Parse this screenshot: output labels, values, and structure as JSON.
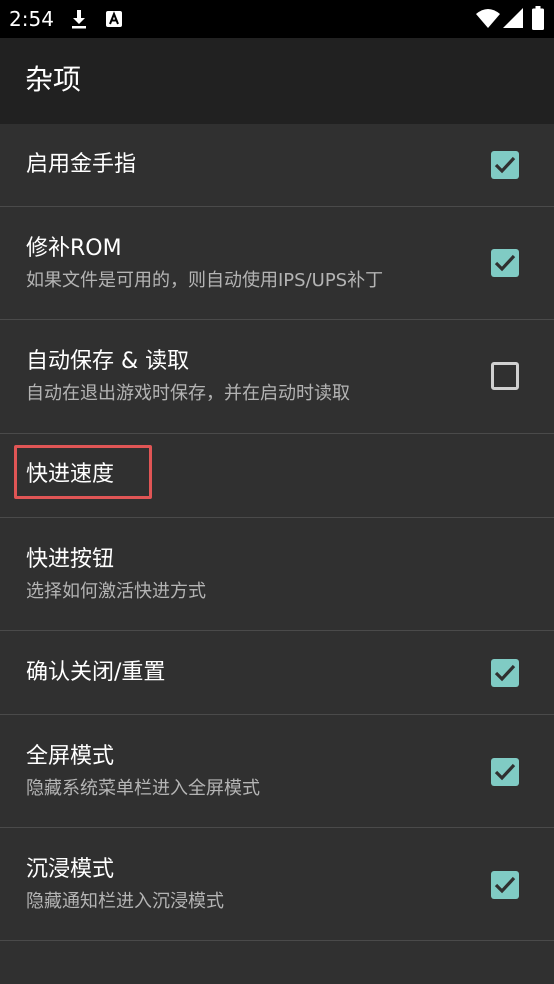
{
  "status_bar": {
    "time": "2:54",
    "icons": [
      "download-icon",
      "a-letter-notification-icon",
      "wifi-icon",
      "cellular-signal-icon",
      "battery-icon"
    ]
  },
  "toolbar": {
    "title": "杂项"
  },
  "preferences": [
    {
      "title": "启用金手指",
      "summary": "",
      "checkbox": "checked"
    },
    {
      "title": "修补ROM",
      "summary": "如果文件是可用的，则自动使用IPS/UPS补丁",
      "checkbox": "checked"
    },
    {
      "title": "自动保存 & 读取",
      "summary": "自动在退出游戏时保存，并在启动时读取",
      "checkbox": "unchecked"
    },
    {
      "title": "快进速度",
      "summary": "",
      "checkbox": "none"
    },
    {
      "title": "快进按钮",
      "summary": "选择如何激活快进方式",
      "checkbox": "none"
    },
    {
      "title": "确认关闭/重置",
      "summary": "",
      "checkbox": "checked"
    },
    {
      "title": "全屏模式",
      "summary": "隐藏系统菜单栏进入全屏模式",
      "checkbox": "checked"
    },
    {
      "title": "沉浸模式",
      "summary": "隐藏通知栏进入沉浸模式",
      "checkbox": "checked"
    }
  ],
  "colors": {
    "accent": "#80cbc4",
    "background": "#303030",
    "toolbar": "#212121",
    "highlight": "#e05555"
  }
}
